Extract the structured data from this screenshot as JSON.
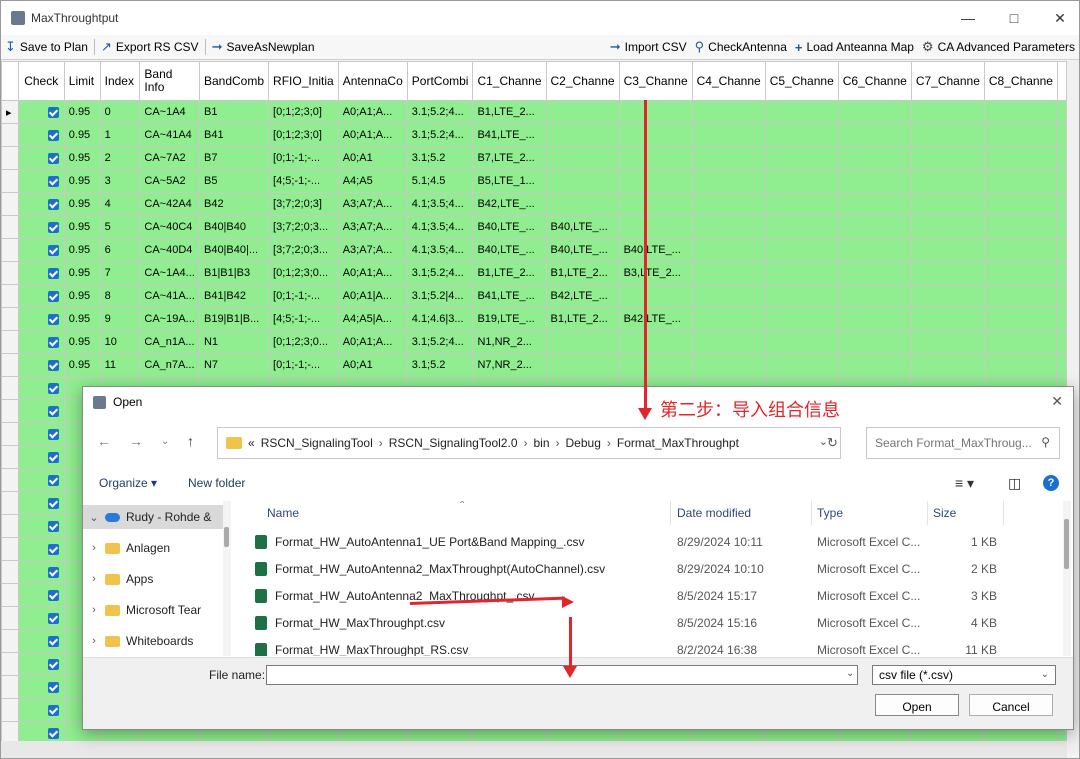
{
  "window": {
    "title": "MaxThroughtput"
  },
  "toolbar": {
    "save_to_plan": "Save to Plan",
    "export_rs_csv": "Export RS CSV",
    "save_as_newplan": "SaveAsNewplan",
    "import_csv": "Import CSV",
    "check_antenna": "CheckAntenna",
    "load_antenna_map": "Load Anteanna Map",
    "ca_advanced": "CA Advanced Parameters"
  },
  "grid": {
    "columns": [
      "Check",
      "Limit",
      "Index",
      "Band Info",
      "BandComb",
      "RFIO_Initia",
      "AntennaCo",
      "PortCombi",
      "C1_Channe",
      "C2_Channe",
      "C3_Channe",
      "C4_Channe",
      "C5_Channe",
      "C6_Channe",
      "C7_Channe",
      "C8_Channe"
    ],
    "rows": [
      {
        "limit": "0.95",
        "index": "0",
        "band": "CA~1A4",
        "comb": "B1",
        "rfio": "[0;1;2;3;0]",
        "ant": "A0;A1;A...",
        "port": "3.1;5.2;4...",
        "c1": "B1,LTE_2...",
        "c2": "",
        "c3": ""
      },
      {
        "limit": "0.95",
        "index": "1",
        "band": "CA~41A4",
        "comb": "B41",
        "rfio": "[0;1;2;3;0]",
        "ant": "A0;A1;A...",
        "port": "3.1;5.2;4...",
        "c1": "B41,LTE_...",
        "c2": "",
        "c3": ""
      },
      {
        "limit": "0.95",
        "index": "2",
        "band": "CA~7A2",
        "comb": "B7",
        "rfio": "[0;1;-1;-...",
        "ant": "A0;A1",
        "port": "3.1;5.2",
        "c1": "B7,LTE_2...",
        "c2": "",
        "c3": ""
      },
      {
        "limit": "0.95",
        "index": "3",
        "band": "CA~5A2",
        "comb": "B5",
        "rfio": "[4;5;-1;-...",
        "ant": "A4;A5",
        "port": "5.1;4.5",
        "c1": "B5,LTE_1...",
        "c2": "",
        "c3": ""
      },
      {
        "limit": "0.95",
        "index": "4",
        "band": "CA~42A4",
        "comb": "B42",
        "rfio": "[3;7;2;0;3]",
        "ant": "A3;A7;A...",
        "port": "4.1;3.5;4...",
        "c1": "B42,LTE_...",
        "c2": "",
        "c3": ""
      },
      {
        "limit": "0.95",
        "index": "5",
        "band": "CA~40C4",
        "comb": "B40|B40",
        "rfio": "[3;7;2;0;3...",
        "ant": "A3;A7;A...",
        "port": "4.1;3.5;4...",
        "c1": "B40,LTE_...",
        "c2": "B40,LTE_...",
        "c3": ""
      },
      {
        "limit": "0.95",
        "index": "6",
        "band": "CA~40D4",
        "comb": "B40|B40|...",
        "rfio": "[3;7;2;0;3...",
        "ant": "A3;A7;A...",
        "port": "4.1;3.5;4...",
        "c1": "B40,LTE_...",
        "c2": "B40,LTE_...",
        "c3": "B40,LTE_..."
      },
      {
        "limit": "0.95",
        "index": "7",
        "band": "CA~1A4...",
        "comb": "B1|B1|B3",
        "rfio": "[0;1;2;3;0...",
        "ant": "A0;A1;A...",
        "port": "3.1;5.2;4...",
        "c1": "B1,LTE_2...",
        "c2": "B1,LTE_2...",
        "c3": "B3,LTE_2..."
      },
      {
        "limit": "0.95",
        "index": "8",
        "band": "CA~41A...",
        "comb": "B41|B42",
        "rfio": "[0;1;-1;-...",
        "ant": "A0;A1|A...",
        "port": "3.1;5.2|4...",
        "c1": "B41,LTE_...",
        "c2": "B42,LTE_...",
        "c3": ""
      },
      {
        "limit": "0.95",
        "index": "9",
        "band": "CA~19A...",
        "comb": "B19|B1|B...",
        "rfio": "[4;5;-1;-...",
        "ant": "A4;A5|A...",
        "port": "4.1;4.6|3...",
        "c1": "B19,LTE_...",
        "c2": "B1,LTE_2...",
        "c3": "B42,LTE_..."
      },
      {
        "limit": "0.95",
        "index": "10",
        "band": "CA_n1A...",
        "comb": "N1",
        "rfio": "[0;1;2;3;0...",
        "ant": "A0;A1;A...",
        "port": "3.1;5.2;4...",
        "c1": "N1,NR_2...",
        "c2": "",
        "c3": ""
      },
      {
        "limit": "0.95",
        "index": "11",
        "band": "CA_n7A...",
        "comb": "N7",
        "rfio": "[0;1;-1;-...",
        "ant": "A0;A1",
        "port": "3.1;5.2",
        "c1": "N7,NR_2...",
        "c2": "",
        "c3": ""
      }
    ]
  },
  "dialog": {
    "title": "Open",
    "path": [
      "«",
      "RSCN_SignalingTool",
      "RSCN_SignalingTool2.0",
      "bin",
      "Debug",
      "Format_MaxThroughpt"
    ],
    "search_placeholder": "Search Format_MaxThroug...",
    "organize": "Organize ▾",
    "new_folder": "New folder",
    "nav": [
      {
        "label": "Rudy - Rohde &",
        "icon": "cloud-icon"
      },
      {
        "label": "Anlagen",
        "icon": "folder-icon"
      },
      {
        "label": "Apps",
        "icon": "folder-icon"
      },
      {
        "label": "Microsoft Tear",
        "icon": "folder-icon"
      },
      {
        "label": "Whiteboards",
        "icon": "folder-icon"
      }
    ],
    "headers": {
      "name": "Name",
      "date": "Date modified",
      "type": "Type",
      "size": "Size"
    },
    "files": [
      {
        "name": "Format_HW_AutoAntenna1_UE Port&Band Mapping_.csv",
        "date": "8/29/2024 10:11",
        "type": "Microsoft Excel C...",
        "size": "1 KB"
      },
      {
        "name": "Format_HW_AutoAntenna2_MaxThroughpt(AutoChannel).csv",
        "date": "8/29/2024 10:10",
        "type": "Microsoft Excel C...",
        "size": "2 KB"
      },
      {
        "name": "Format_HW_AutoAntenna2_MaxThroughpt_.csv",
        "date": "8/5/2024 15:17",
        "type": "Microsoft Excel C...",
        "size": "3 KB"
      },
      {
        "name": "Format_HW_MaxThroughpt.csv",
        "date": "8/5/2024 15:16",
        "type": "Microsoft Excel C...",
        "size": "4 KB"
      },
      {
        "name": "Format_HW_MaxThroughpt_RS.csv",
        "date": "8/2/2024 16:38",
        "type": "Microsoft Excel C...",
        "size": "11 KB"
      }
    ],
    "file_name_label": "File name:",
    "file_name_value": "",
    "file_type": "csv file (*.csv)",
    "open_label": "Open",
    "cancel_label": "Cancel"
  },
  "annotation": {
    "text": "第二步：导入组合信息",
    "color": "#e1252b"
  },
  "colors": {
    "row_bg": "#90ee90",
    "checkbox": "#1a6fd1"
  }
}
